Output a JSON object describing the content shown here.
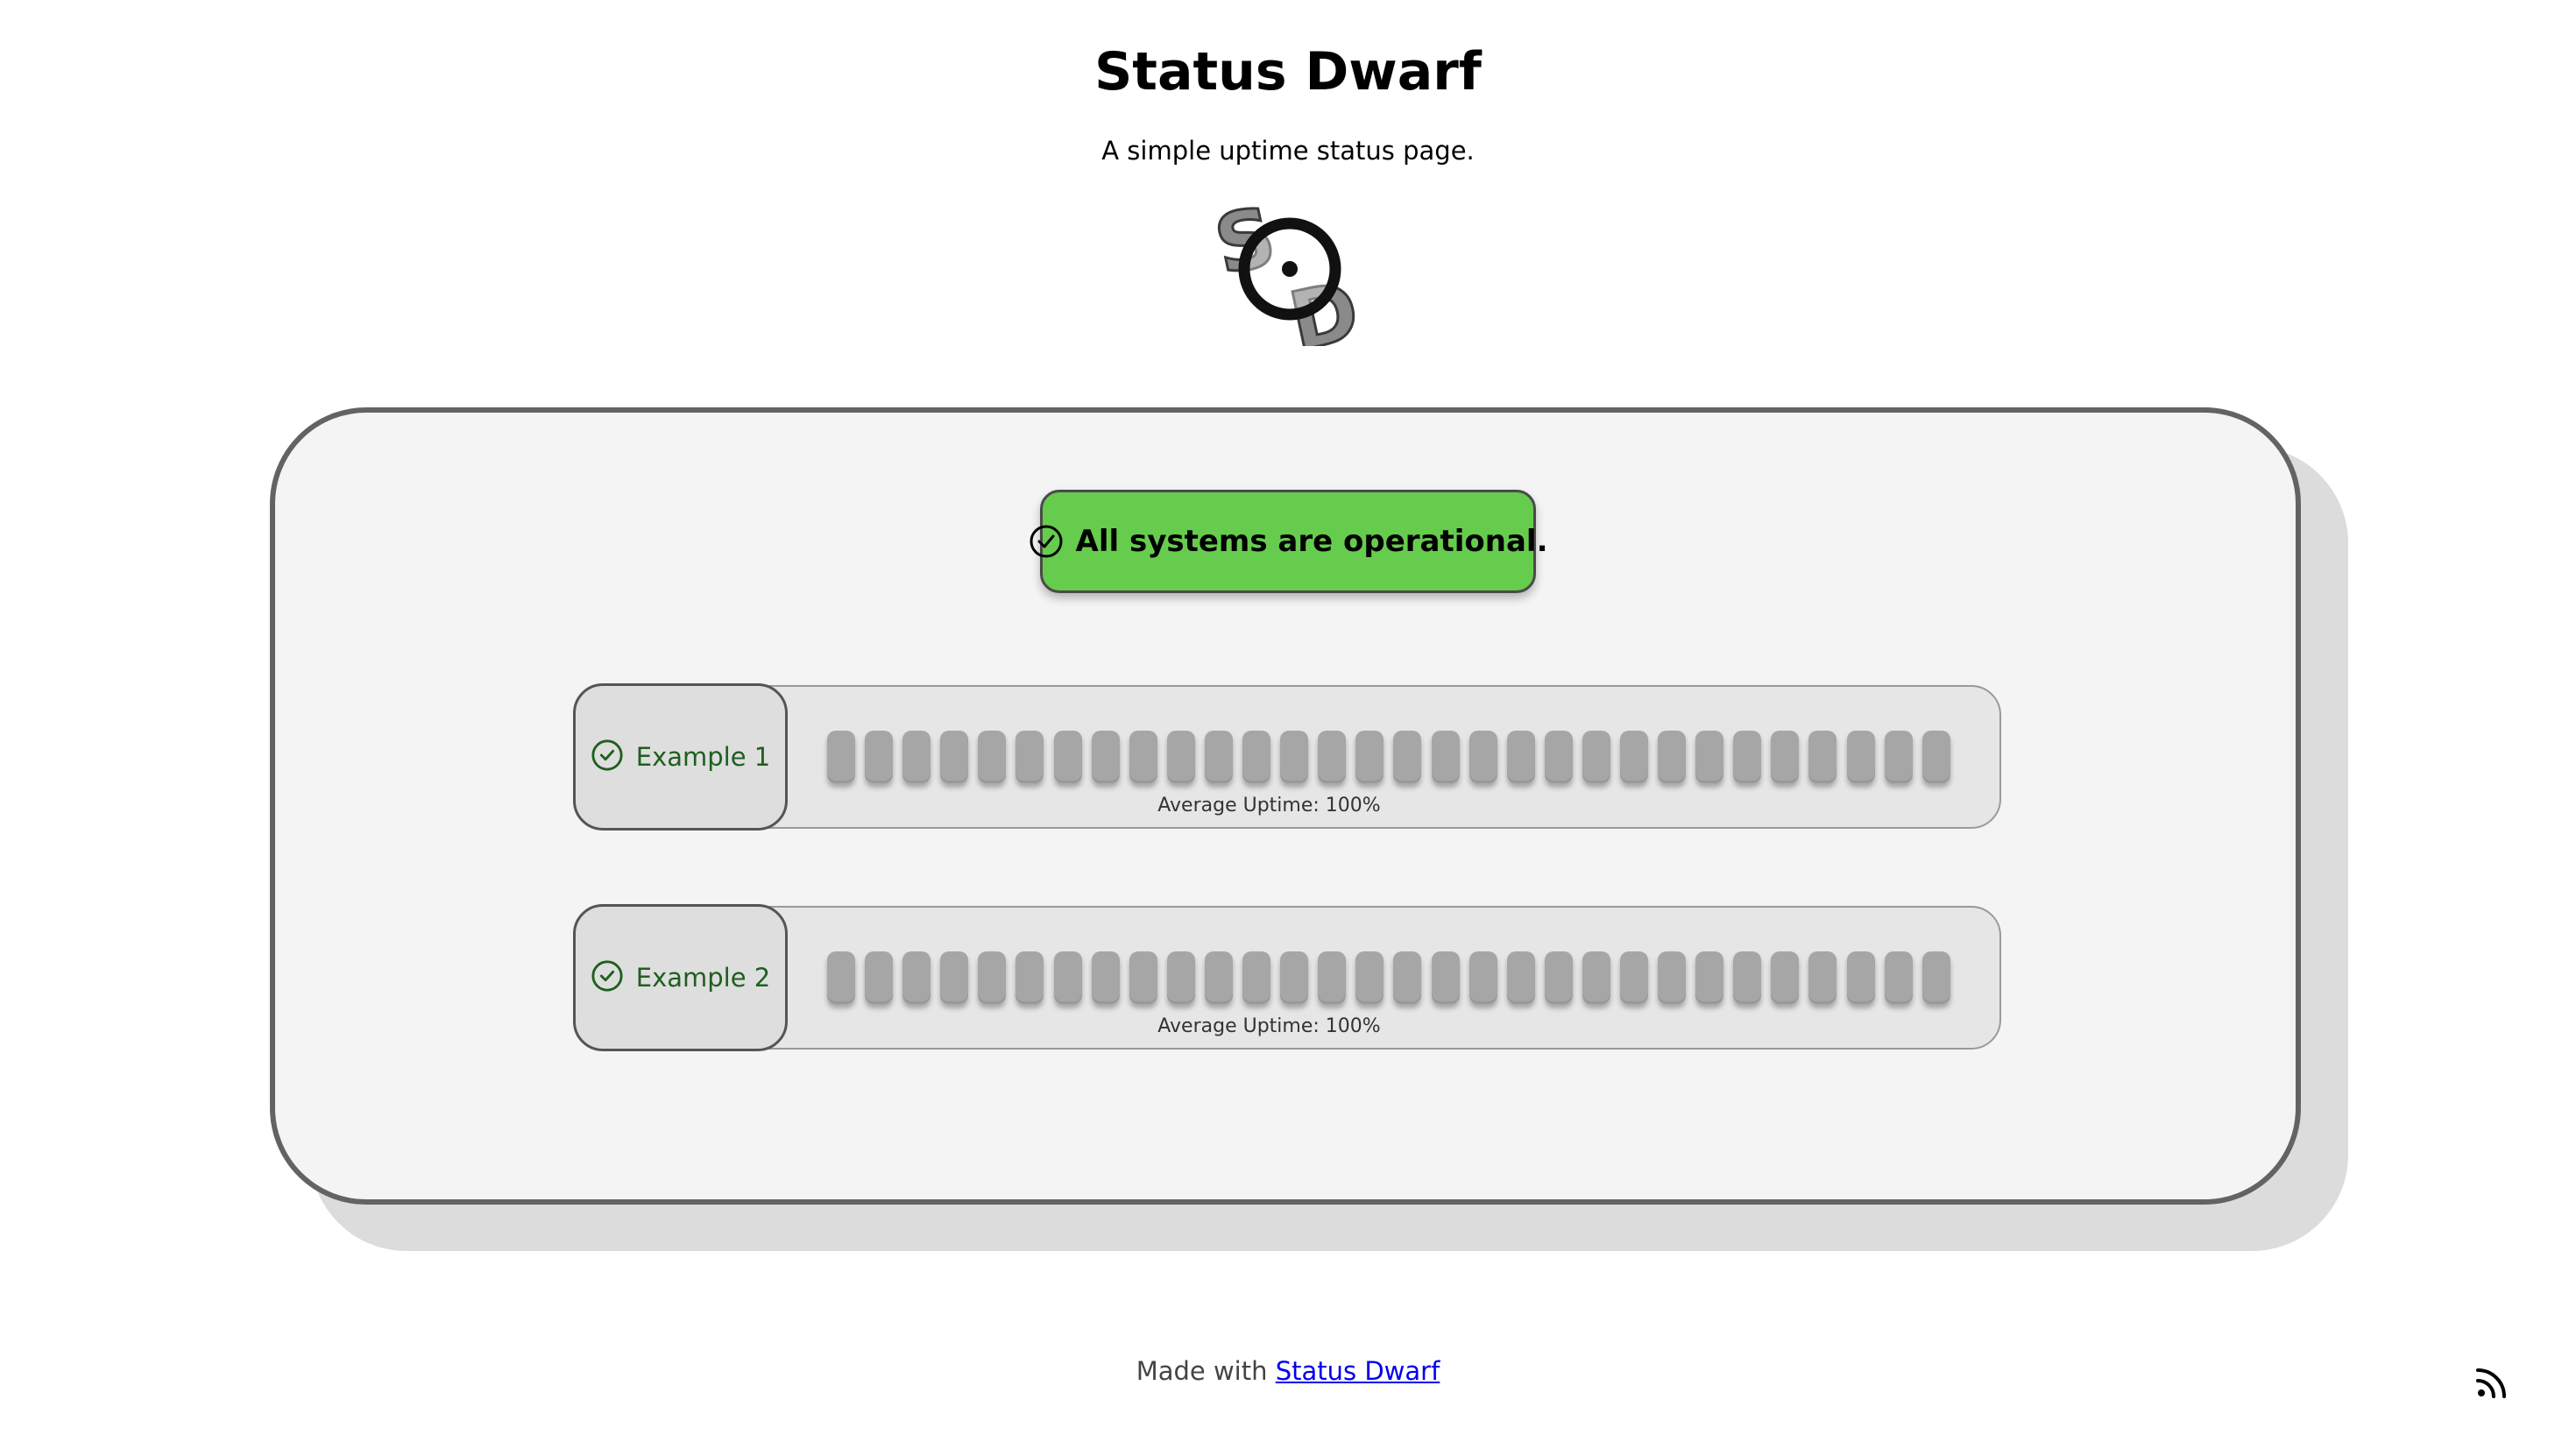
{
  "header": {
    "title": "Status Dwarf",
    "subtitle": "A simple uptime status page.",
    "logo_text": "SD"
  },
  "overall_status": {
    "text": "All systems are operational.",
    "color": "#66cc4d",
    "icon": "check-circle-icon"
  },
  "services": [
    {
      "name": "Example 1",
      "status_icon": "check-circle-icon",
      "status_color": "#1f5f1f",
      "days": 30,
      "uptime_label": "Average Uptime: 100%"
    },
    {
      "name": "Example 2",
      "status_icon": "check-circle-icon",
      "status_color": "#1f5f1f",
      "days": 30,
      "uptime_label": "Average Uptime: 100%"
    }
  ],
  "footer": {
    "prefix": "Made with ",
    "link_text": "Status Dwarf"
  },
  "rss_icon": "rss-icon"
}
